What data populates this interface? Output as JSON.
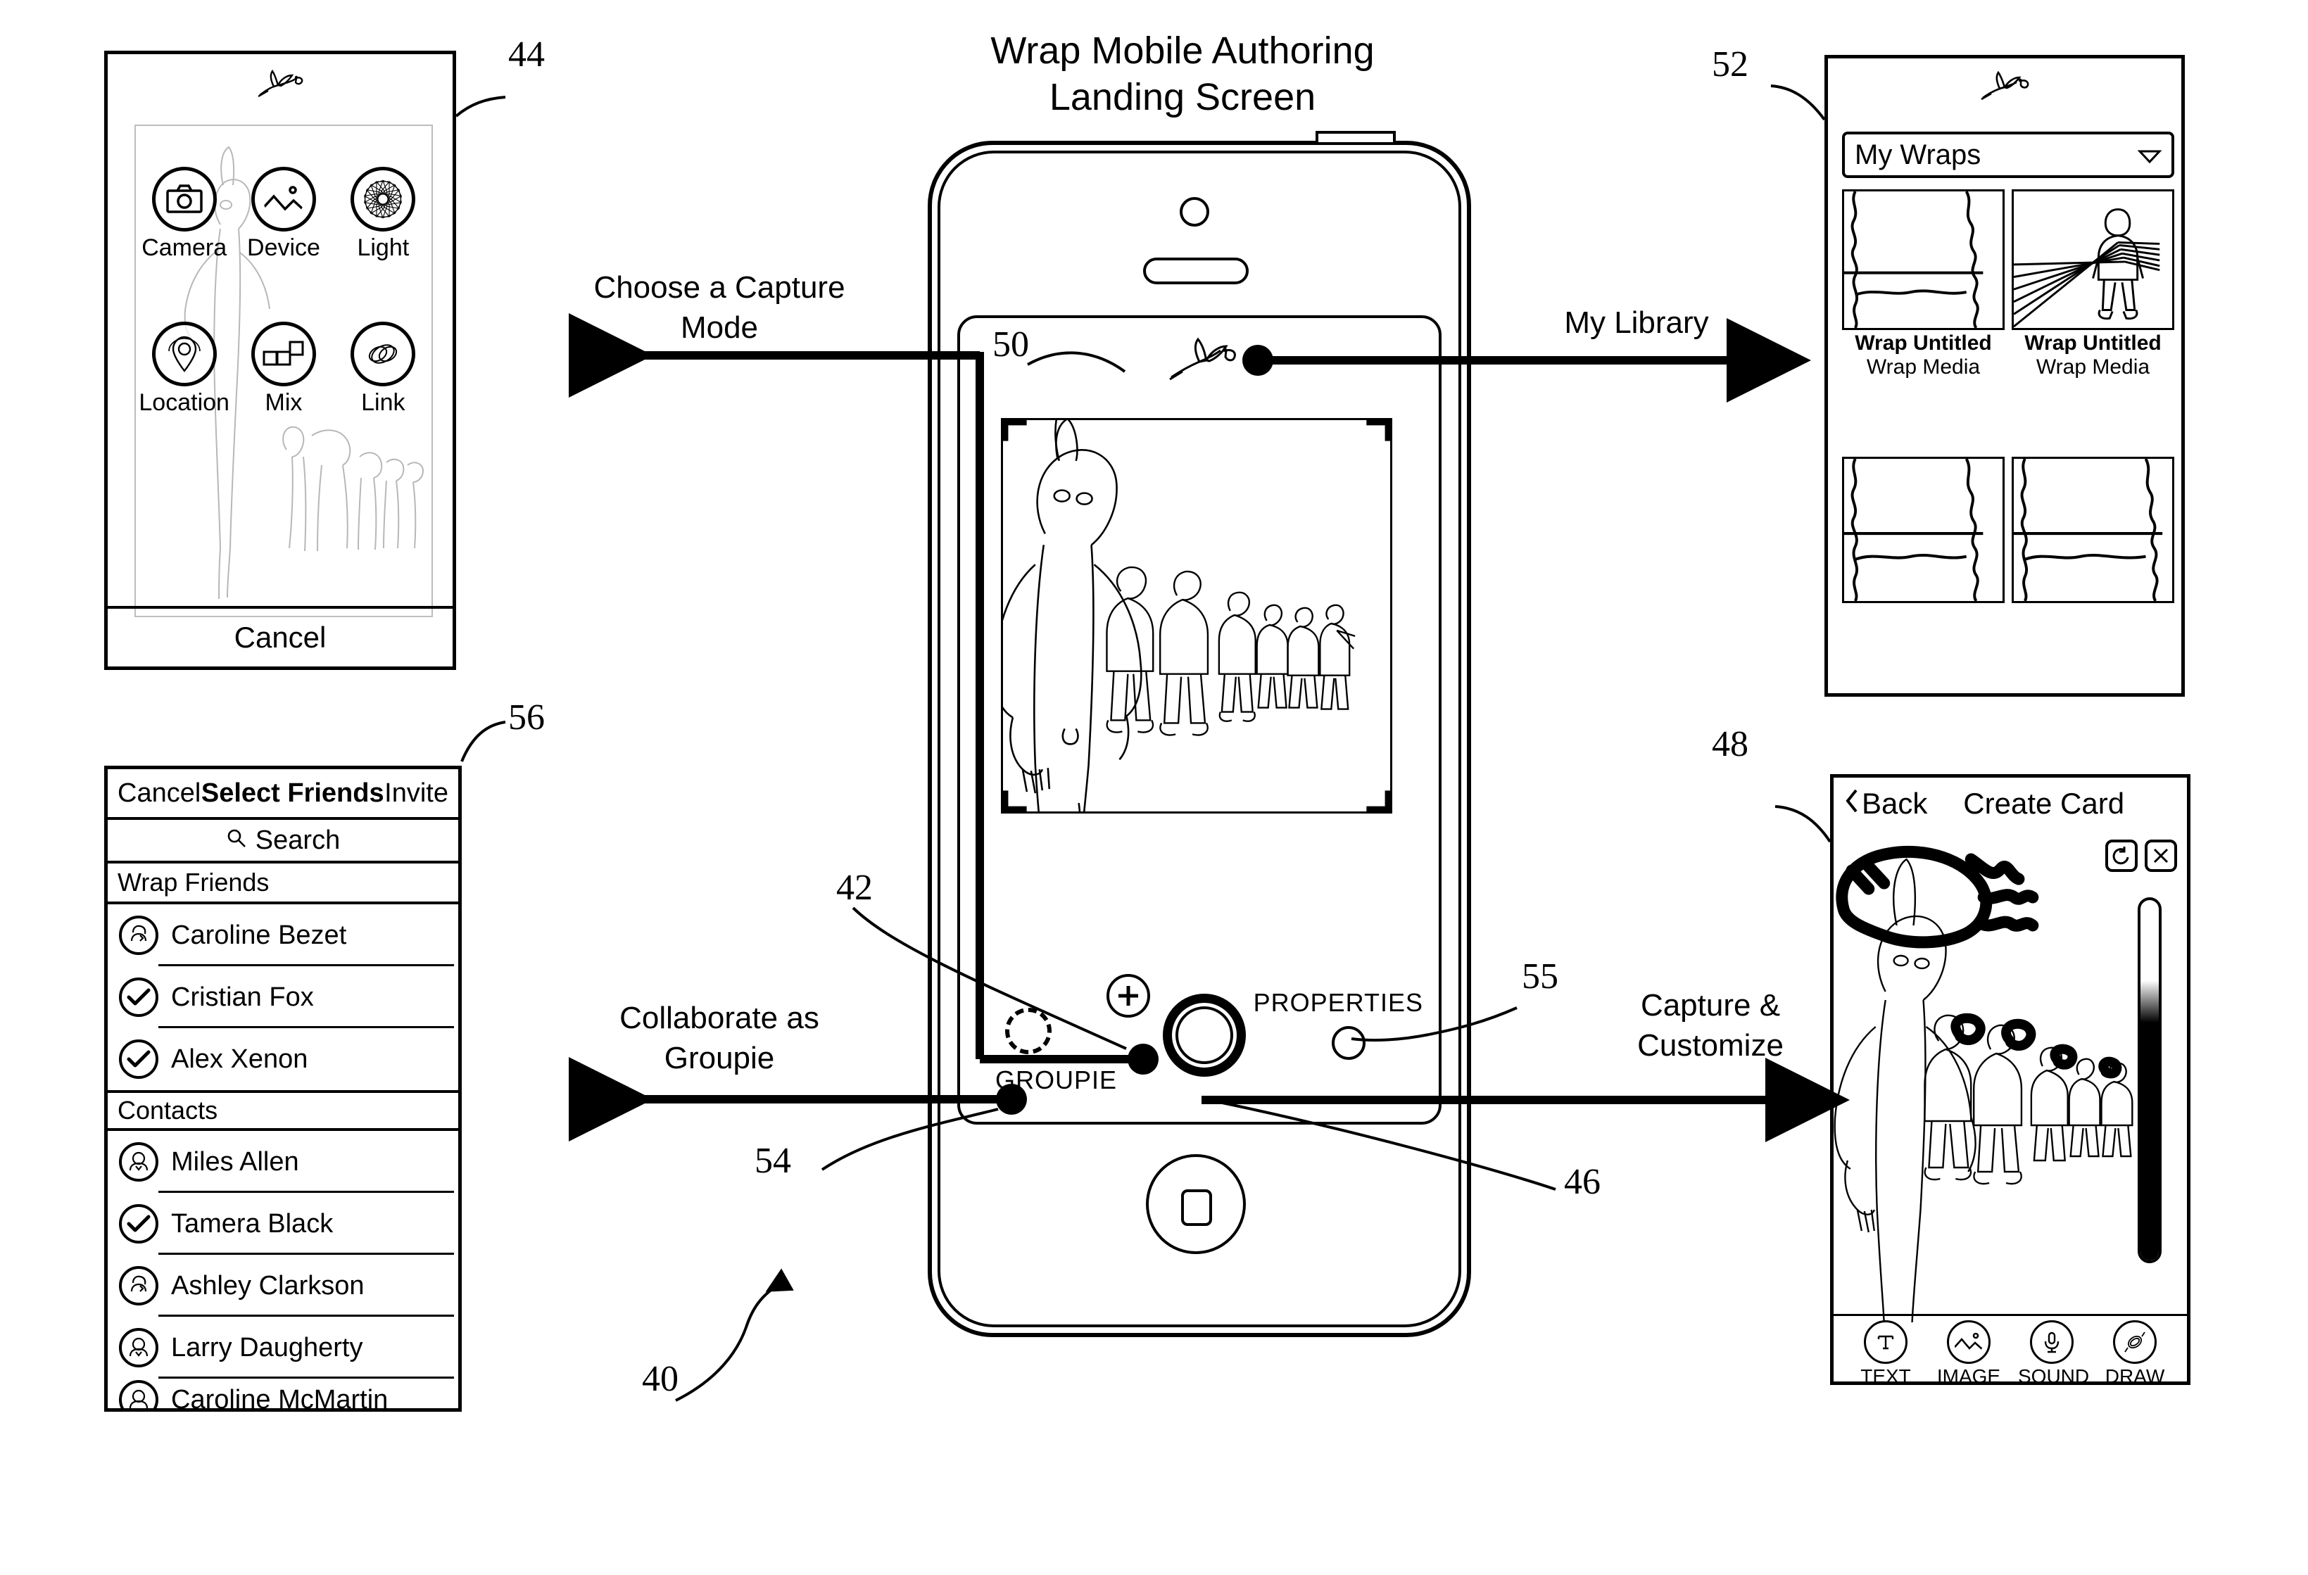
{
  "figure": {
    "title_line1": "Wrap Mobile Authoring",
    "title_line2": "Landing Screen",
    "ref_overall": "40",
    "ref_plus_button": "42",
    "ref_capture_panel": "44",
    "ref_shutter": "46",
    "ref_create_card_panel": "48",
    "ref_landing_logo": "50",
    "ref_library_panel": "52",
    "ref_groupie": "54",
    "ref_properties": "55",
    "ref_friends_panel": "56"
  },
  "callouts": {
    "choose_capture_mode": "Choose a Capture\nMode",
    "choose_capture_mode_l1": "Choose a Capture",
    "choose_capture_mode_l2": "Mode",
    "my_library": "My Library",
    "collaborate_l1": "Collaborate as",
    "collaborate_l2": "Groupie",
    "capture_customize_l1": "Capture &",
    "capture_customize_l2": "Customize"
  },
  "phone": {
    "groupie_label": "GROUPIE",
    "properties_label": "PROPERTIES",
    "plus_label": "+"
  },
  "capture_panel": {
    "modes": [
      {
        "label": "Camera",
        "icon": "camera-icon"
      },
      {
        "label": "Device",
        "icon": "image-icon"
      },
      {
        "label": "Light",
        "icon": "burst-icon"
      },
      {
        "label": "Location",
        "icon": "map-pin-icon"
      },
      {
        "label": "Mix",
        "icon": "mix-icon"
      },
      {
        "label": "Link",
        "icon": "link-icon"
      }
    ],
    "cancel_label": "Cancel"
  },
  "friends_panel": {
    "cancel_label": "Cancel",
    "title": "Select Friends",
    "invite_label": "Invite",
    "search_placeholder": "Search",
    "sections": [
      {
        "header": "Wrap Friends",
        "rows": [
          {
            "name": "Caroline Bezet",
            "selected": false
          },
          {
            "name": "Cristian Fox",
            "selected": true
          },
          {
            "name": "Alex Xenon",
            "selected": true
          }
        ]
      },
      {
        "header": "Contacts",
        "rows": [
          {
            "name": "Miles Allen",
            "selected": false
          },
          {
            "name": "Tamera Black",
            "selected": true
          },
          {
            "name": "Ashley Clarkson",
            "selected": false
          },
          {
            "name": "Larry Daugherty",
            "selected": false
          },
          {
            "name": "Caroline McMartin",
            "selected": false
          }
        ]
      }
    ]
  },
  "library_panel": {
    "selected_filter": "My Wraps",
    "dropdown_icon": "chevron-down-icon",
    "items": [
      {
        "title": "Wrap Untitled",
        "subtitle": "Wrap Media",
        "thumb": "landscape-thumb"
      },
      {
        "title": "Wrap Untitled",
        "subtitle": "Wrap Media",
        "thumb": "person-rays-thumb"
      },
      {
        "title": "",
        "subtitle": "",
        "thumb": "landscape-thumb"
      },
      {
        "title": "",
        "subtitle": "",
        "thumb": "landscape-thumb"
      }
    ]
  },
  "create_card_panel": {
    "back_label": "Back",
    "title": "Create Card",
    "undo_icon": "undo-icon",
    "close_icon": "close-icon",
    "tools": [
      {
        "label": "TEXT",
        "icon": "text-icon"
      },
      {
        "label": "IMAGE",
        "icon": "image-icon"
      },
      {
        "label": "SOUND",
        "icon": "microphone-icon"
      },
      {
        "label": "DRAW",
        "icon": "draw-icon"
      }
    ],
    "slider_value_pct": 66
  }
}
